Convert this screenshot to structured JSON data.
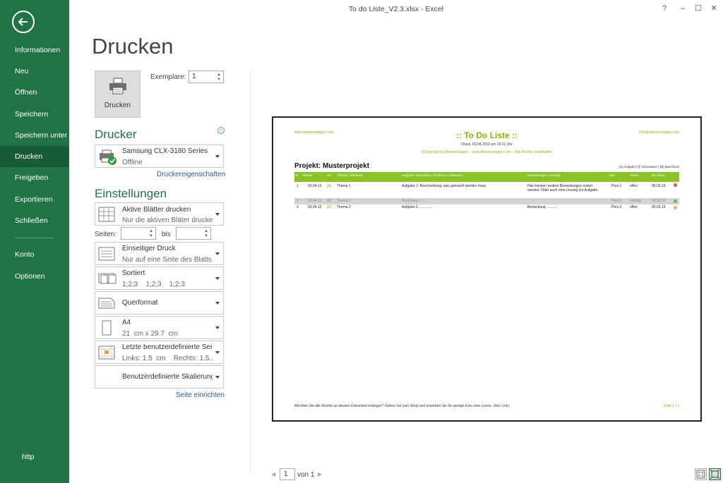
{
  "window": {
    "title": "To do Liste_V2.3.xlsx - Excel",
    "help": "?",
    "minimize": "–",
    "restore": "☐",
    "close": "✕"
  },
  "sidebar": {
    "items": [
      {
        "label": "Informationen"
      },
      {
        "label": "Neu"
      },
      {
        "label": "Öffnen"
      },
      {
        "label": "Speichern"
      },
      {
        "label": "Speichern unter"
      },
      {
        "label": "Drucken",
        "active": true
      },
      {
        "label": "Freigeben"
      },
      {
        "label": "Exportieren"
      },
      {
        "label": "Schließen"
      },
      {
        "label": "Konto"
      },
      {
        "label": "Optionen"
      }
    ],
    "footer": "http"
  },
  "print": {
    "title": "Drucken",
    "button_label": "Drucken",
    "copies_label": "Exemplare:",
    "copies_value": "1"
  },
  "printer": {
    "heading": "Drucker",
    "info": "i",
    "name": "Samsung CLX-3180 Series",
    "status": "Offline",
    "properties_link": "Druckereigenschaften"
  },
  "settings": {
    "heading": "Einstellungen",
    "what": {
      "l1": "Aktive Blätter drucken",
      "l2": "Nur die aktiven Bläter drucken"
    },
    "pages_label": "Seiten:",
    "pages_to_label": "bis",
    "sides": {
      "l1": "Einseitiger Druck",
      "l2": "Nur auf eine Seite des Blatts..."
    },
    "collate": {
      "l1": "Sortiert",
      "l2": "1;2;3    1;2;3    1;2;3"
    },
    "orientation": {
      "l1": "Querformat"
    },
    "paper": {
      "l1": "A4",
      "l2": "21  cm x 29.7  cm"
    },
    "margins": {
      "l1": "Letzte benutzerdefinierte Sei...",
      "l2": "Links: 1.5  cm    Rechts: 1.5..."
    },
    "scaling": {
      "l1": "Benutzerdefinierte Skalierung"
    },
    "page_setup_link": "Seite einrichten"
  },
  "preview": {
    "site_left": "www.meinevorlagen.com",
    "site_right": "info@meinevorlagen.com",
    "title": ":: To Do Liste ::",
    "print_date": "Druck: 03.04.2013 um 15:21 Uhr",
    "copyright": "©Copyright by Meinevorlagen – www.Meinevorlagen.com – Alle Rechte vorbehalten",
    "project": "Projekt:  Musterprojekt",
    "legend": "[A] Aufgabe  |  [I] Information  |  [B] Beschluss",
    "columns": [
      "Nr.",
      "Datum",
      "Art",
      "Thema / Stichwort",
      "Aufgabe / Beschluss / Probleme / Hinweise",
      "Bemerkungen / Lösung",
      "Wer",
      "Status",
      "bis Wann"
    ],
    "rows": [
      {
        "nr": "1",
        "datum": "03.04.13",
        "art": "[A]",
        "thema": "Thema 1",
        "aufgabe": "Aufgabe 1:  Beschreibung, was gemacht werden muss",
        "bem": "Hier können weitere Bemerkungen notiert",
        "bem2": "werden. Oder auch eine Lösung zur Aufgabe.",
        "wer": "Pers.1",
        "status": "offen",
        "bis": "05.03.13",
        "dot": "#d9534f",
        "grey": false
      },
      {
        "nr": "2",
        "datum": "03.04.13",
        "art": "[B]",
        "thema": "Thema 2",
        "aufgabe": "Beschluss 1 ......",
        "bem": "",
        "bem2": "",
        "wer": "Pers.2",
        "status": "erledigt",
        "bis": "05.03.13",
        "dot": "#5cb85c",
        "grey": true
      },
      {
        "nr": "3",
        "datum": "03.04.13",
        "art": "[A]",
        "thema": "Thema 2",
        "aufgabe": "Aufgabe 2 ..............",
        "bem": "Bemerkung ...........",
        "bem2": "",
        "wer": "Pers.3",
        "status": "offen",
        "bis": "05.03.13",
        "dot": "#f0ad4e",
        "grey": false
      }
    ],
    "footer_text": "Möchten Sie alle Rechte an diesem Dokument erlangen? Gehen Sie zum Shop und erwerben Sie für wenige Euro eine Lizenz. (hier Link)",
    "page_indicator": "Seite 1 / 1"
  },
  "pager": {
    "current": "1",
    "total_label": "von 1"
  },
  "colors": {
    "brand": "#217346",
    "brand_dark": "#185c37",
    "preview_green": "#8bc326"
  }
}
